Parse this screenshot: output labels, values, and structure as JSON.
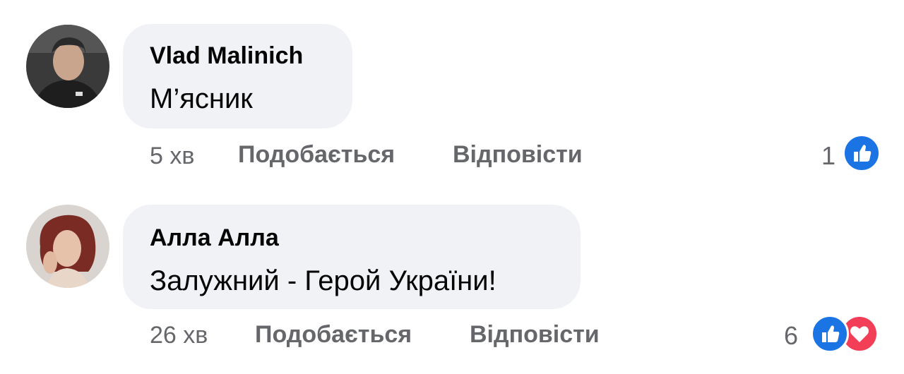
{
  "comments": [
    {
      "author": "Vlad Malinich",
      "text": "М’ясник",
      "time": "5 хв",
      "like_label": "Подобається",
      "reply_label": "Відповісти",
      "reaction_count": "1",
      "reactions": [
        "like-icon"
      ]
    },
    {
      "author": "Алла Алла",
      "text": "Залужний - Герой України!",
      "time": "26 хв",
      "like_label": "Подобається",
      "reply_label": "Відповісти",
      "reaction_count": "6",
      "reactions": [
        "like-icon",
        "love-icon"
      ]
    }
  ],
  "colors": {
    "bubble": "#f0f2f5",
    "meta_text": "#65676b",
    "like": "#1b74e4",
    "love": "#f33e58"
  }
}
